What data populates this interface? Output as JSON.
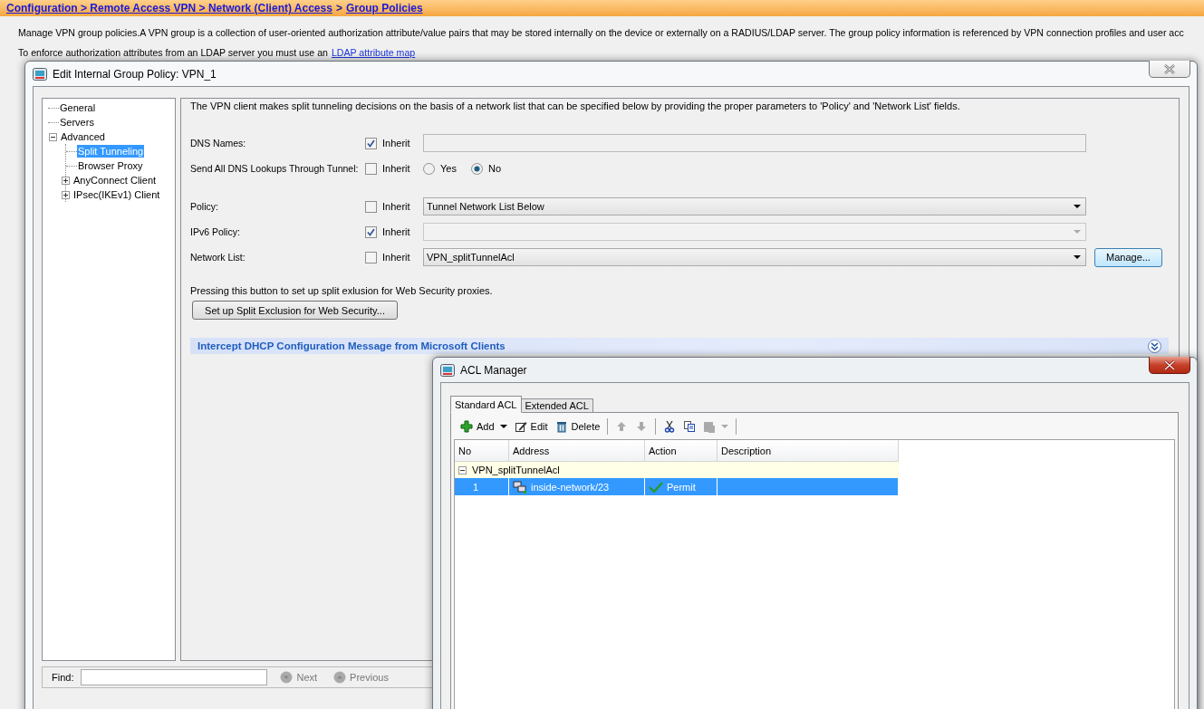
{
  "breadcrumb": {
    "links": [
      "Configuration > Remote Access VPN > Network (Client) Access",
      "Group Policies"
    ],
    "separator": ">"
  },
  "page": {
    "description": "Manage VPN group policies.A VPN group is a collection of user-oriented authorization attribute/value pairs that may be stored internally on the device or externally on a RADIUS/LDAP server. The group policy information is referenced by VPN connection profiles and user acc",
    "ldap_note": "To enforce authorization attributes from an LDAP server you must use an",
    "ldap_link": "LDAP attribute map"
  },
  "edit_dialog": {
    "title": "Edit Internal Group Policy: VPN_1",
    "tree": [
      {
        "label": "General",
        "selected": false
      },
      {
        "label": "Servers",
        "selected": false
      },
      {
        "label": "Advanced",
        "selected": false,
        "expanded": true,
        "children": [
          {
            "label": "Split Tunneling",
            "selected": true
          },
          {
            "label": "Browser Proxy",
            "selected": false
          },
          {
            "label": "AnyConnect Client",
            "selected": false,
            "expanded": false
          },
          {
            "label": "IPsec(IKEv1) Client",
            "selected": false,
            "expanded": false
          }
        ]
      }
    ],
    "intro": "The VPN client makes split tunneling decisions on the basis of a network list that can be specified below by providing the proper parameters to 'Policy' and 'Network List' fields.",
    "dns_fields": [
      {
        "kind": "text",
        "label": "DNS Names:",
        "inherit": true,
        "inherit_label": "Inherit"
      },
      {
        "kind": "radio",
        "label": "Send All DNS Lookups Through Tunnel:",
        "inherit": false,
        "inherit_label": "Inherit",
        "options": [
          {
            "label": "Yes",
            "selected": false
          },
          {
            "label": "No",
            "selected": true
          }
        ]
      }
    ],
    "policy_fields": [
      {
        "kind": "select",
        "label": "Policy:",
        "inherit": false,
        "inherit_label": "Inherit",
        "value": "Tunnel Network List Below"
      },
      {
        "kind": "select",
        "label": "IPv6 Policy:",
        "inherit": true,
        "inherit_label": "Inherit"
      },
      {
        "kind": "select",
        "label": "Network List:",
        "inherit": false,
        "inherit_label": "Inherit",
        "value": "VPN_splitTunnelAcl",
        "button": "Manage..."
      }
    ],
    "exclusion_note": "Pressing this button to set up split exlusion for Web Security proxies.",
    "exclusion_button": "Set up Split Exclusion for Web Security...",
    "intercept_section": {
      "title": "Intercept DHCP Configuration Message from Microsoft Clients",
      "expanded": false
    },
    "find": {
      "label": "Find:",
      "next": "Next",
      "previous": "Previous"
    }
  },
  "acl_dialog": {
    "title": "ACL Manager",
    "tabs": [
      {
        "label": "Standard ACL",
        "selected": true
      },
      {
        "label": "Extended ACL",
        "selected": false
      }
    ],
    "toolbar": [
      {
        "kind": "button",
        "label": "Add",
        "menu": true,
        "disabled": false
      },
      {
        "kind": "button",
        "label": "Edit",
        "disabled": false
      },
      {
        "kind": "button",
        "label": "Delete",
        "disabled": false
      },
      {
        "kind": "separator"
      },
      {
        "kind": "button",
        "disabled": true
      },
      {
        "kind": "button",
        "disabled": true
      },
      {
        "kind": "separator"
      },
      {
        "kind": "button",
        "disabled": false
      },
      {
        "kind": "button",
        "disabled": false
      },
      {
        "kind": "button",
        "menu": true,
        "disabled": true
      },
      {
        "kind": "separator"
      }
    ],
    "columns": [
      "No",
      "Address",
      "Action",
      "Description"
    ],
    "groups": [
      {
        "label": "VPN_splitTunnelAcl",
        "expanded": true,
        "rows": [
          {
            "no": "1",
            "address": "inside-network/23",
            "action": "Permit",
            "selected": true
          }
        ]
      }
    ]
  }
}
